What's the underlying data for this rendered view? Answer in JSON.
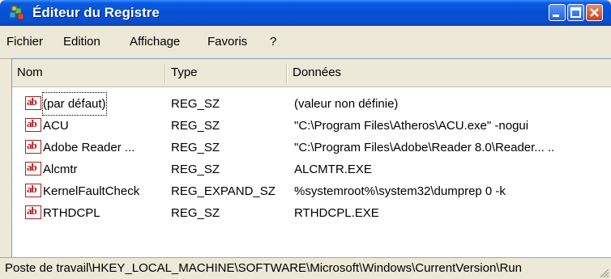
{
  "window": {
    "title": "Éditeur du Registre"
  },
  "menu": {
    "fichier": "Fichier",
    "edition": "Edition",
    "affichage": "Affichage",
    "favoris": "Favoris",
    "help": "?"
  },
  "columns": {
    "name": "Nom",
    "type": "Type",
    "data": "Données"
  },
  "rows": [
    {
      "name": "(par défaut)",
      "type": "REG_SZ",
      "data": "(valeur non définie)"
    },
    {
      "name": "ACU",
      "type": "REG_SZ",
      "data": "\"C:\\Program Files\\Atheros\\ACU.exe\" -nogui"
    },
    {
      "name": "Adobe Reader ...",
      "type": "REG_SZ",
      "data": "\"C:\\Program Files\\Adobe\\Reader 8.0\\Reader... .."
    },
    {
      "name": "Alcmtr",
      "type": "REG_SZ",
      "data": "ALCMTR.EXE"
    },
    {
      "name": "KernelFaultCheck",
      "type": "REG_EXPAND_SZ",
      "data": "%systemroot%\\system32\\dumprep 0 -k"
    },
    {
      "name": "RTHDCPL",
      "type": "REG_SZ",
      "data": "RTHDCPL.EXE"
    }
  ],
  "status": {
    "path": "Poste de travail\\HKEY_LOCAL_MACHINE\\SOFTWARE\\Microsoft\\Windows\\CurrentVersion\\Run"
  },
  "icons": {
    "value_icon": "ab-string-value-icon",
    "app_icon": "registry-cubes-icon"
  }
}
